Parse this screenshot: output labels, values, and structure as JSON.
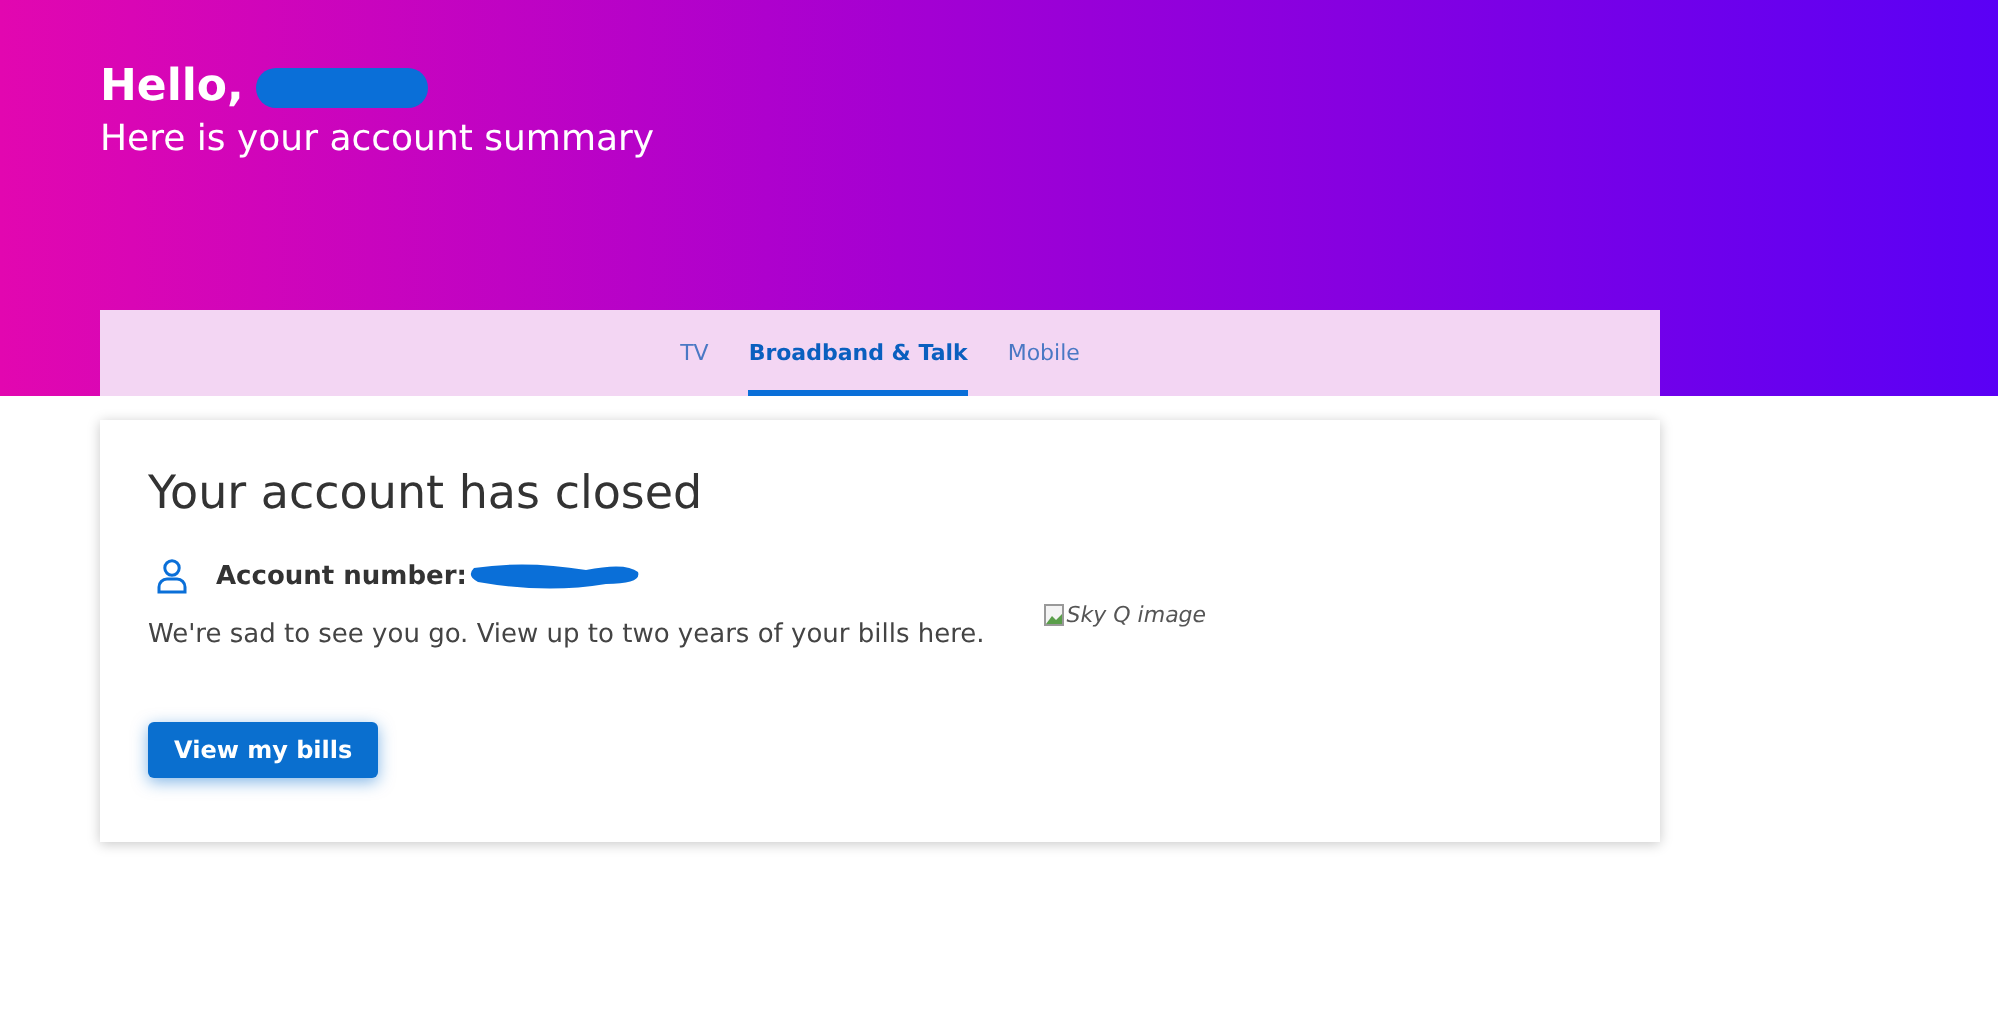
{
  "header": {
    "greeting": "Hello,",
    "subtitle": "Here is your account summary"
  },
  "tabs": [
    {
      "label": "TV",
      "selected": false
    },
    {
      "label": "Broadband & Talk",
      "selected": true
    },
    {
      "label": "Mobile",
      "selected": false
    }
  ],
  "card": {
    "title": "Your account has closed",
    "account_label": "Account number:",
    "message": "We're sad to see you go. View up to two years of your bills here.",
    "image_alt": "Sky Q image",
    "button": "View my bills"
  }
}
